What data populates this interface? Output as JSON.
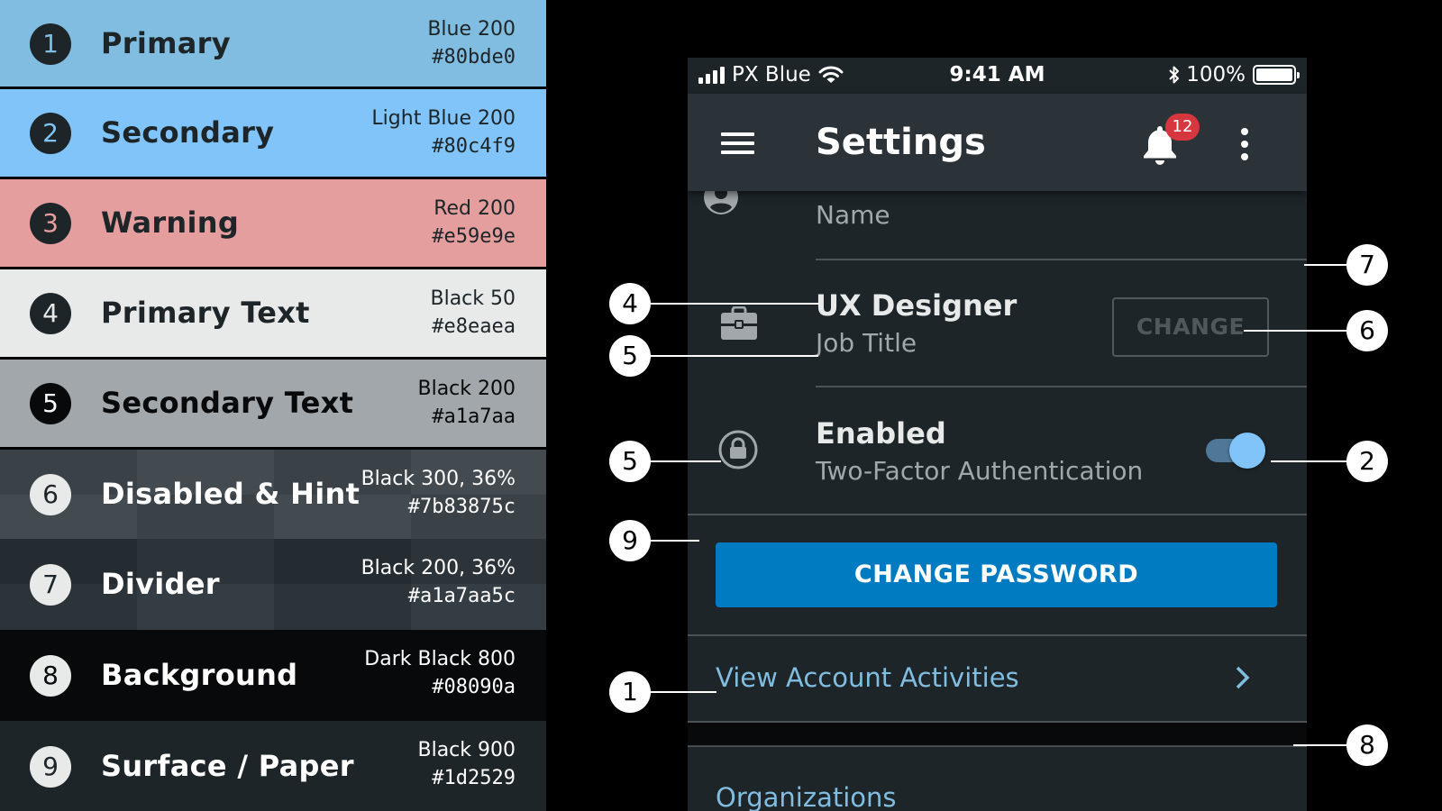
{
  "palette": [
    {
      "num": "1",
      "label": "Primary",
      "name": "Blue 200",
      "hex": "#80bde0"
    },
    {
      "num": "2",
      "label": "Secondary",
      "name": "Light Blue 200",
      "hex": "#80c4f9"
    },
    {
      "num": "3",
      "label": "Warning",
      "name": "Red 200",
      "hex": "#e59e9e"
    },
    {
      "num": "4",
      "label": "Primary Text",
      "name": "Black 50",
      "hex": "#e8eaea"
    },
    {
      "num": "5",
      "label": "Secondary Text",
      "name": "Black 200",
      "hex": "#a1a7aa"
    },
    {
      "num": "6",
      "label": "Disabled & Hint",
      "name": "Black 300, 36%",
      "hex": "#7b83875c"
    },
    {
      "num": "7",
      "label": "Divider",
      "name": "Black 200, 36%",
      "hex": "#a1a7aa5c"
    },
    {
      "num": "8",
      "label": "Background",
      "name": "Dark Black 800",
      "hex": "#08090a"
    },
    {
      "num": "9",
      "label": "Surface / Paper",
      "name": "Black 900",
      "hex": "#1d2529"
    }
  ],
  "phone": {
    "statusbar": {
      "carrier": "PX Blue",
      "time": "9:41 AM",
      "battery": "100%"
    },
    "appbar": {
      "title": "Settings",
      "badge": "12"
    },
    "name_row": {
      "subtitle": "Name"
    },
    "job_row": {
      "title": "UX Designer",
      "subtitle": "Job Title",
      "action": "CHANGE"
    },
    "tfa_row": {
      "title": "Enabled",
      "subtitle": "Two-Factor Authentication",
      "toggle_on": true
    },
    "change_password": "CHANGE PASSWORD",
    "account_link": "View Account Activities",
    "organizations": "Organizations"
  },
  "callouts": [
    "7",
    "4",
    "6",
    "5",
    "5",
    "2",
    "9",
    "1",
    "8"
  ],
  "colors": {
    "app_bar": "#2b3338",
    "surface": "#1d2529",
    "background": "#08090a",
    "primary_button": "#007bc1",
    "badge": "#d6363e"
  }
}
